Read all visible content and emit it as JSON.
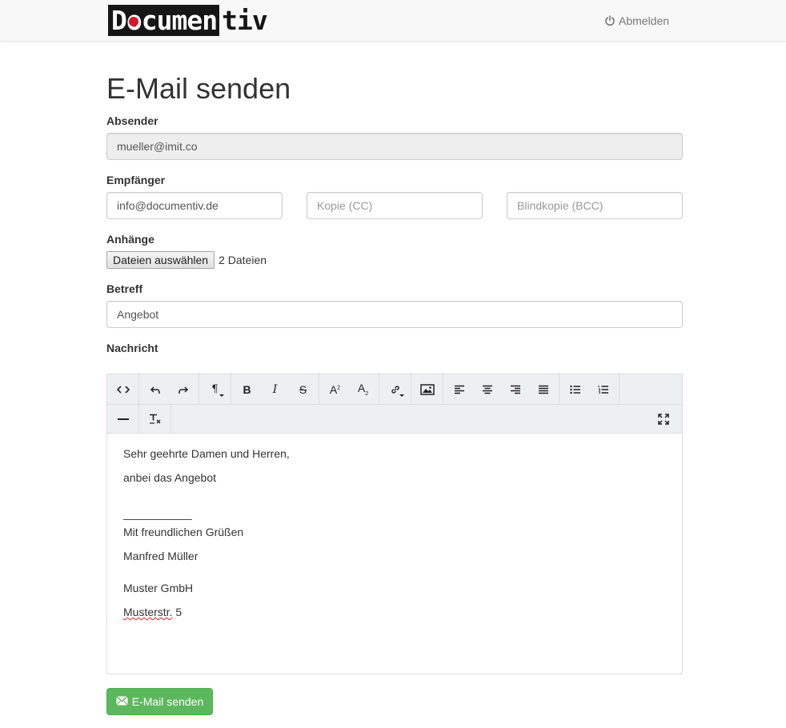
{
  "header": {
    "logo_dark": "Documen",
    "logo_light": "tiv",
    "logout_label": "Abmelden"
  },
  "page": {
    "title": "E-Mail senden"
  },
  "sender": {
    "label": "Absender",
    "value": "mueller@imit.co"
  },
  "recipients": {
    "label": "Empfänger",
    "to_value": "info@documentiv.de",
    "cc_placeholder": "Kopie (CC)",
    "bcc_placeholder": "Blindkopie (BCC)"
  },
  "attachments": {
    "label": "Anhänge",
    "button_label": "Dateien auswählen",
    "status": "2 Dateien"
  },
  "subject": {
    "label": "Betreff",
    "value": "Angebot"
  },
  "message": {
    "label": "Nachricht",
    "lines": {
      "greeting": "Sehr geehrte Damen und Herren,",
      "body": "anbei das Angebot",
      "separator": "___________",
      "closing": "Mit freundlichen Grüßen",
      "name": "Manfred Müller",
      "company": "Muster GmbH",
      "street_word": "Musterstr.",
      "street_number": " 5"
    }
  },
  "toolbar": {
    "icons": [
      "code-view-icon",
      "undo-icon",
      "redo-icon",
      "paragraph-icon",
      "bold-icon",
      "italic-icon",
      "strikethrough-icon",
      "superscript-icon",
      "subscript-icon",
      "link-icon",
      "image-icon",
      "align-left-icon",
      "align-center-icon",
      "align-right-icon",
      "align-justify-icon",
      "unordered-list-icon",
      "ordered-list-icon",
      "horizontal-rule-icon",
      "clear-format-icon",
      "fullscreen-icon"
    ]
  },
  "actions": {
    "send_label": "E-Mail senden"
  },
  "colors": {
    "success": "#5cb85c",
    "logo_red": "#d7172b",
    "toolbar_bg": "#ecf0f1"
  }
}
